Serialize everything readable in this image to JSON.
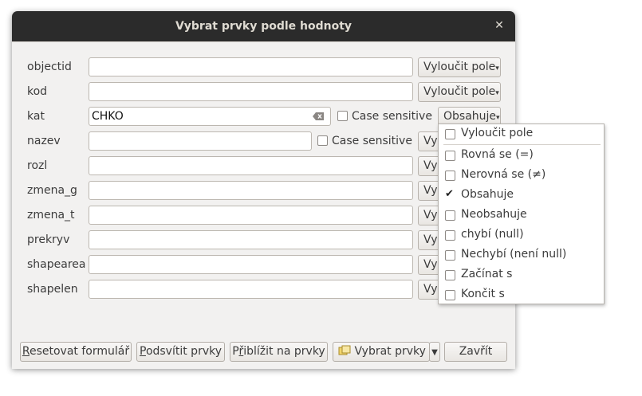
{
  "window": {
    "title": "Vybrat prvky podle hodnoty"
  },
  "fields": [
    {
      "label": "objectid",
      "value": "",
      "button": "Vyloučit pole"
    },
    {
      "label": "kod",
      "value": "",
      "button": "Vyloučit pole"
    },
    {
      "label": "kat",
      "value": "CHKO",
      "case_label": "Case sensitive",
      "button": "Obsahuje"
    },
    {
      "label": "nazev",
      "value": "",
      "case_label": "Case sensitive",
      "button": "Vy"
    },
    {
      "label": "rozl",
      "value": "",
      "button": "Vy"
    },
    {
      "label": "zmena_g",
      "value": "",
      "button": "Vy"
    },
    {
      "label": "zmena_t",
      "value": "",
      "button": "Vy"
    },
    {
      "label": "prekryv",
      "value": "",
      "button": "Vy"
    },
    {
      "label": "shapearea",
      "value": "",
      "button": "Vy"
    },
    {
      "label": "shapelen",
      "value": "",
      "button": "Vy"
    }
  ],
  "menu": {
    "items": [
      {
        "label": "Vyloučit pole",
        "checked": false
      },
      {
        "label": "Rovná se (=)",
        "checked": false
      },
      {
        "label": "Nerovná se (≠)",
        "checked": false
      },
      {
        "label": "Obsahuje",
        "checked": true
      },
      {
        "label": "Neobsahuje",
        "checked": false
      },
      {
        "label": "chybí (null)",
        "checked": false
      },
      {
        "label": "Nechybí (není null)",
        "checked": false
      },
      {
        "label": "Začínat s",
        "checked": false
      },
      {
        "label": "Končit s",
        "checked": false
      }
    ]
  },
  "buttons": {
    "reset_first": "R",
    "reset_rest": "esetovat formulář",
    "highlight_first": "P",
    "highlight_rest": "odsvítit prvky",
    "zoom_first": "P",
    "zoom_u": "ř",
    "zoom_rest": "iblížit na prvky",
    "select": "Vybrat prvky",
    "close": "Zavřít"
  },
  "icons": {
    "close": "close-icon",
    "clear": "clear-text-icon",
    "select": "select-features-icon",
    "dropdown": "dropdown-arrow-icon"
  }
}
